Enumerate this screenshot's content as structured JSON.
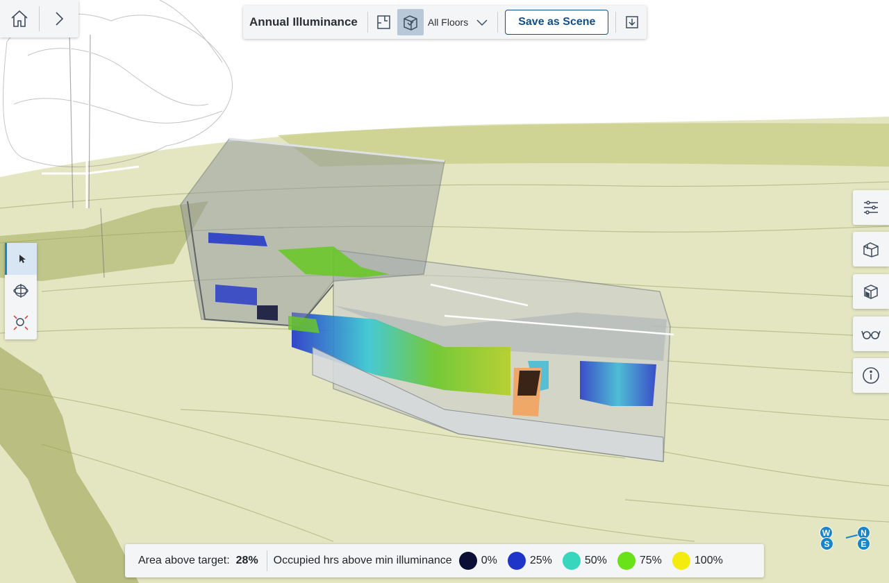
{
  "toolbar": {
    "title": "Annual Illuminance",
    "floor_select": "All Floors",
    "save_label": "Save as Scene"
  },
  "legend": {
    "area_label": "Area above target:",
    "area_value": "28%",
    "occupied_label": "Occupied hrs above min illuminance",
    "items": [
      {
        "label": "0%",
        "color": "#0b0f35"
      },
      {
        "label": "25%",
        "color": "#1f35c9"
      },
      {
        "label": "50%",
        "color": "#37d6bd"
      },
      {
        "label": "75%",
        "color": "#6ae21a"
      },
      {
        "label": "100%",
        "color": "#f5ec0f"
      }
    ]
  },
  "compass": {
    "w": "W",
    "s": "S",
    "n": "N",
    "e": "E"
  },
  "colors": {
    "accent": "#0e4f8c",
    "highlight": "#1a84c9",
    "terrain": "#e6e8c6"
  }
}
